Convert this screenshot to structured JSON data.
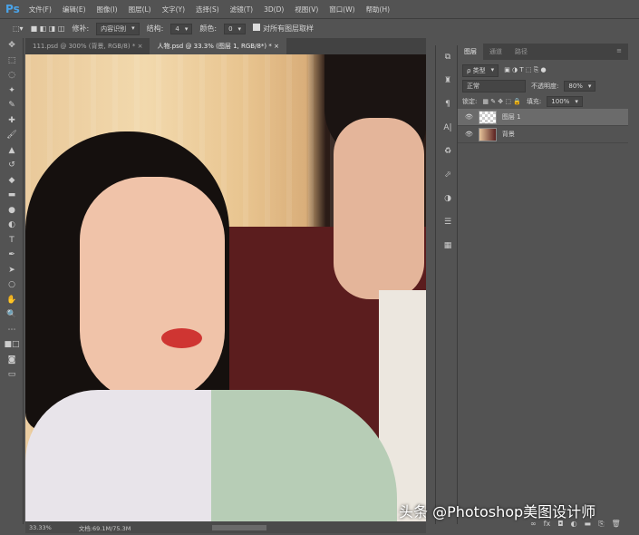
{
  "app": {
    "logo": "Ps"
  },
  "menu": [
    "文件(F)",
    "编辑(E)",
    "图像(I)",
    "图层(L)",
    "文字(Y)",
    "选择(S)",
    "滤镜(T)",
    "3D(D)",
    "视图(V)",
    "窗口(W)",
    "帮助(H)"
  ],
  "options": {
    "patch_label": "修补:",
    "patch_value": "内容识别",
    "structure_label": "结构:",
    "structure_value": "4",
    "color_label": "颜色:",
    "color_value": "0",
    "sample_all": "对所有图层取样"
  },
  "tabs": [
    {
      "label": "111.psd @ 300% (背景, RGB/8) *",
      "close": "×"
    },
    {
      "label": "人物.psd @ 33.3% (图层 1, RGB/8*) *",
      "close": "×"
    }
  ],
  "status": {
    "zoom": "33.33%",
    "doc": "文档:69.1M/75.3M"
  },
  "panel": {
    "tabs": [
      "图层",
      "通道",
      "路径"
    ],
    "filter": "ρ 类型",
    "blend": "正常",
    "opacity_label": "不透明度:",
    "opacity": "80%",
    "lock_label": "锁定:",
    "fill_label": "填充:",
    "fill": "100%",
    "layers": [
      {
        "name": "图层 1",
        "selected": true
      },
      {
        "name": "背景",
        "selected": false
      }
    ]
  },
  "watermark": "头条 @Photoshop美图设计师"
}
